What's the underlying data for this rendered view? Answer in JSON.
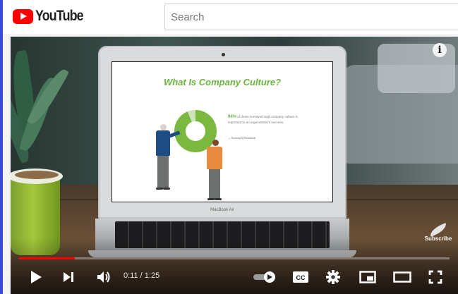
{
  "header": {
    "logo_text": "YouTube",
    "search_placeholder": "Search"
  },
  "video": {
    "slide": {
      "title": "What Is Company Culture?",
      "stat": "94%",
      "body": "of those surveyed said company culture is important to an organization's success.",
      "source": "— Survey/X Research",
      "donut_percent": 94
    },
    "laptop_brand": "MacBook Air",
    "info_icon": "i",
    "subscribe_label": "Subscribe"
  },
  "controls": {
    "current_time": "0:11",
    "duration": "1:25",
    "progress_fraction": 0.13,
    "cc_label": "CC",
    "autoplay_on": true,
    "icons": [
      "play-icon",
      "next-icon",
      "volume-icon",
      "autoplay-toggle-icon",
      "cc-icon",
      "settings-icon",
      "miniplayer-icon",
      "theater-icon",
      "fullscreen-icon"
    ]
  },
  "colors": {
    "brand_red": "#ff0000",
    "slide_green": "#6ab43e",
    "strip_blue": "#3a49d6"
  }
}
